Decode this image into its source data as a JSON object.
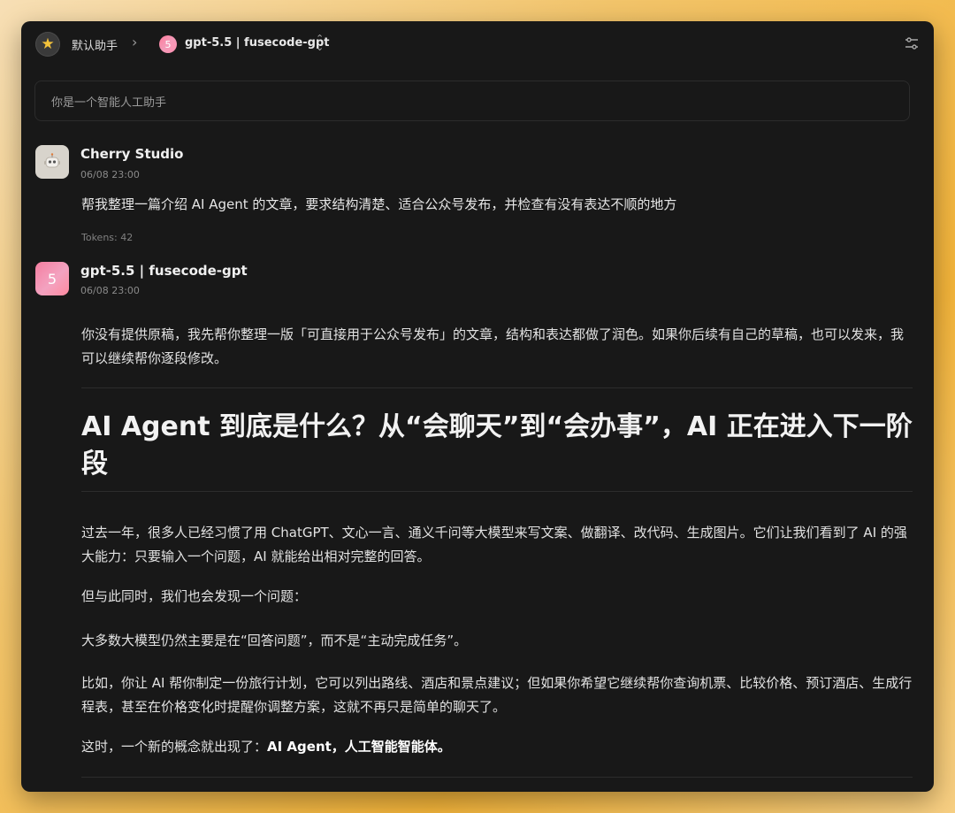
{
  "header": {
    "assistant_name": "默认助手",
    "model_badge": "5",
    "model_name": "gpt-5.5 | fusecode-gpt"
  },
  "system_prompt": "你是一个智能人工助手",
  "messages": [
    {
      "sender": "Cherry Studio",
      "time": "06/08 23:00",
      "text": "帮我整理一篇介绍 AI Agent 的文章，要求结构清楚、适合公众号发布，并检查有没有表达不顺的地方",
      "tokens": "Tokens: 42"
    },
    {
      "sender": "gpt-5.5 | fusecode-gpt",
      "avatar_label": "5",
      "time": "06/08 23:00",
      "intro": "你没有提供原稿，我先帮你整理一版「可直接用于公众号发布」的文章，结构和表达都做了润色。如果你后续有自己的草稿，也可以发来，我可以继续帮你逐段修改。",
      "heading": "AI Agent 到底是什么？从“会聊天”到“会办事”，AI 正在进入下一阶段",
      "p1": "过去一年，很多人已经习惯了用 ChatGPT、文心一言、通义千问等大模型来写文案、做翻译、改代码、生成图片。它们让我们看到了 AI 的强大能力：只要输入一个问题，AI 就能给出相对完整的回答。",
      "p2": "但与此同时，我们也会发现一个问题：",
      "p3": "大多数大模型仍然主要是在“回答问题”，而不是“主动完成任务”。",
      "p4": "比如，你让 AI 帮你制定一份旅行计划，它可以列出路线、酒店和景点建议；但如果你希望它继续帮你查询机票、比较价格、预订酒店、生成行程表，甚至在价格变化时提醒你调整方案，这就不再只是简单的聊天了。",
      "p5_prefix": "这时，一个新的概念就出现了：",
      "p5_bold": "AI Agent，人工智能智能体。"
    }
  ],
  "colors": {
    "window_bg": "#181818",
    "star": "#f4c33a",
    "model_pink": "#f57ea0"
  },
  "icons": {
    "assistant": "star-icon",
    "breadcrumb": "chevron-right-icon",
    "model_select": "chevron-updown-icon",
    "settings": "sliders-icon",
    "user_avatar": "robot-icon"
  }
}
